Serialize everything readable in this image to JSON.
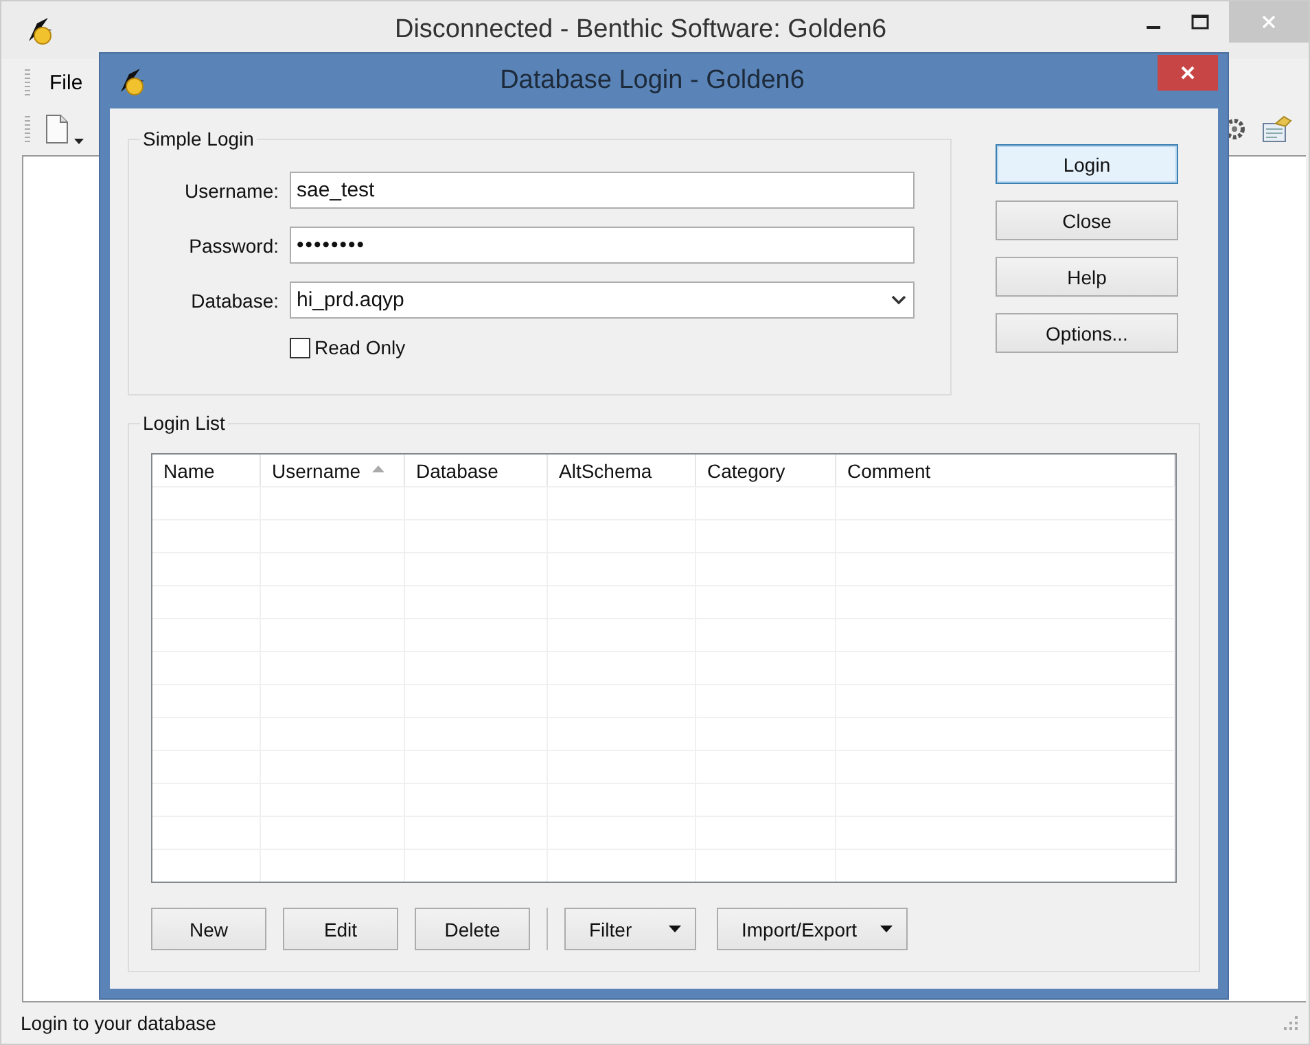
{
  "window": {
    "title": "Disconnected - Benthic Software: Golden6"
  },
  "menu": [
    {
      "label": "File"
    }
  ],
  "status_bar": {
    "text": "Login to your database"
  },
  "dialog": {
    "title": "Database Login - Golden6",
    "simple_login": {
      "title": "Simple Login",
      "fields": [
        {
          "kind": "text",
          "label": "Username:",
          "value": "sae_test"
        },
        {
          "kind": "text",
          "label": "Password:",
          "value": "••••••••"
        },
        {
          "kind": "dropdown",
          "label": "Database:",
          "value": "hi_prd.aqyp"
        }
      ],
      "read_only": {
        "label": "Read Only",
        "checked": false
      }
    },
    "side_buttons": [
      {
        "label": "Login",
        "focused": true
      },
      {
        "label": "Close",
        "focused": false
      },
      {
        "label": "Help",
        "focused": false
      },
      {
        "label": "Options...",
        "focused": false
      }
    ],
    "login_list": {
      "title": "Login List",
      "columns": [
        {
          "label": "Name",
          "sorted": false
        },
        {
          "label": "Username",
          "sorted": true
        },
        {
          "label": "Database",
          "sorted": false
        },
        {
          "label": "AltSchema",
          "sorted": false
        },
        {
          "label": "Category",
          "sorted": false
        },
        {
          "label": "Comment",
          "sorted": false
        }
      ],
      "buttons": [
        {
          "label": "New",
          "kind": "plain"
        },
        {
          "label": "Edit",
          "kind": "plain"
        },
        {
          "label": "Delete",
          "kind": "plain"
        },
        {
          "label": "Filter",
          "kind": "menu"
        },
        {
          "label": "Import/Export",
          "kind": "menu"
        }
      ]
    }
  }
}
